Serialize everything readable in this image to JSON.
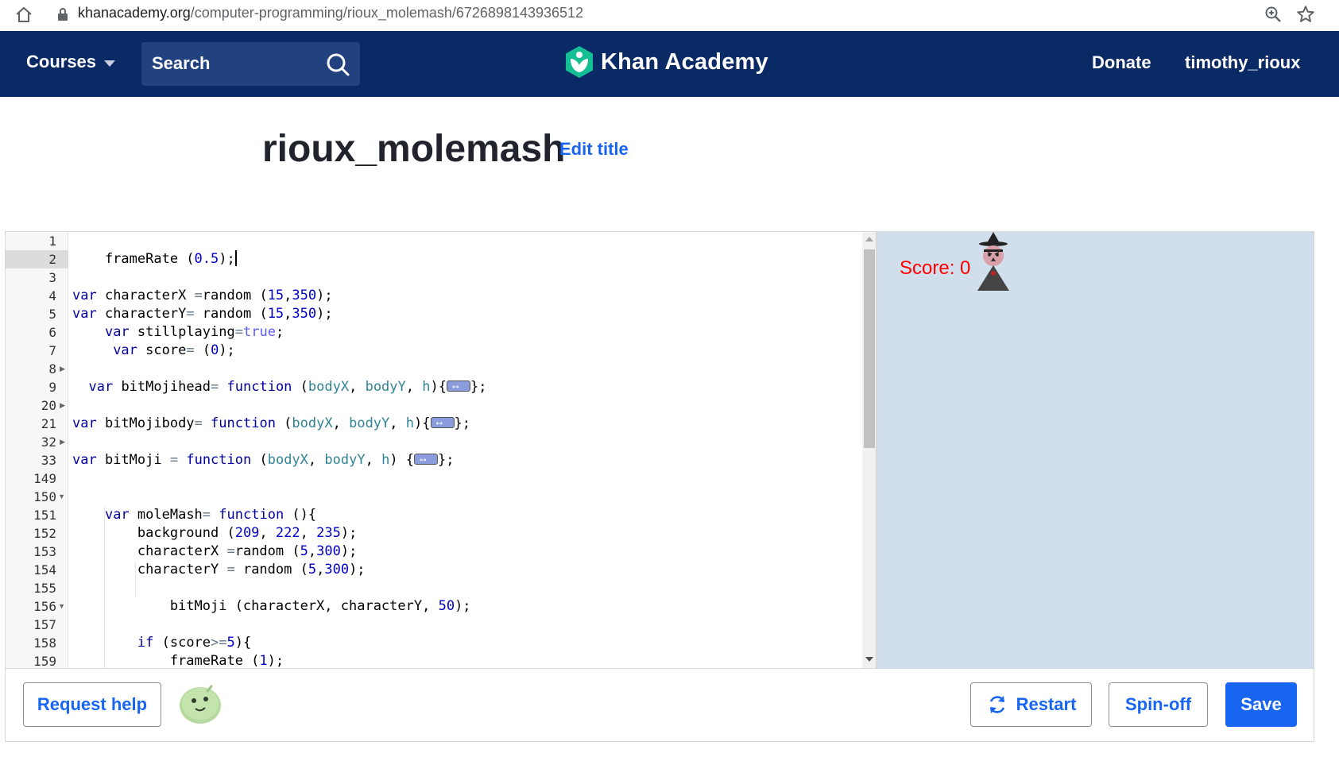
{
  "browser": {
    "url_host": "khanacademy.org",
    "url_path": "/computer-programming/rioux_molemash/6726898143936512"
  },
  "nav": {
    "courses_label": "Courses",
    "search_label": "Search",
    "logo_text": "Khan Academy",
    "donate_label": "Donate",
    "username": "timothy_rioux"
  },
  "project": {
    "title": "rioux_molemash",
    "edit_title_label": "Edit title"
  },
  "editor": {
    "line_numbers": [
      "1",
      "2",
      "3",
      "4",
      "5",
      "6",
      "7",
      "8",
      "9",
      "20",
      "21",
      "32",
      "33",
      "149",
      "150",
      "151",
      "152",
      "153",
      "154",
      "155",
      "156",
      "157",
      "158",
      "159"
    ],
    "active_line": "2"
  },
  "output": {
    "score_text": "Score: 0"
  },
  "toolbar": {
    "request_help_label": "Request help",
    "restart_label": "Restart",
    "spinoff_label": "Spin-off",
    "save_label": "Save"
  },
  "colors": {
    "nav_bg": "#0a2a66",
    "accent": "#1865f2",
    "canvas_bg": "#d1deeb",
    "score_color": "#ff0000"
  }
}
